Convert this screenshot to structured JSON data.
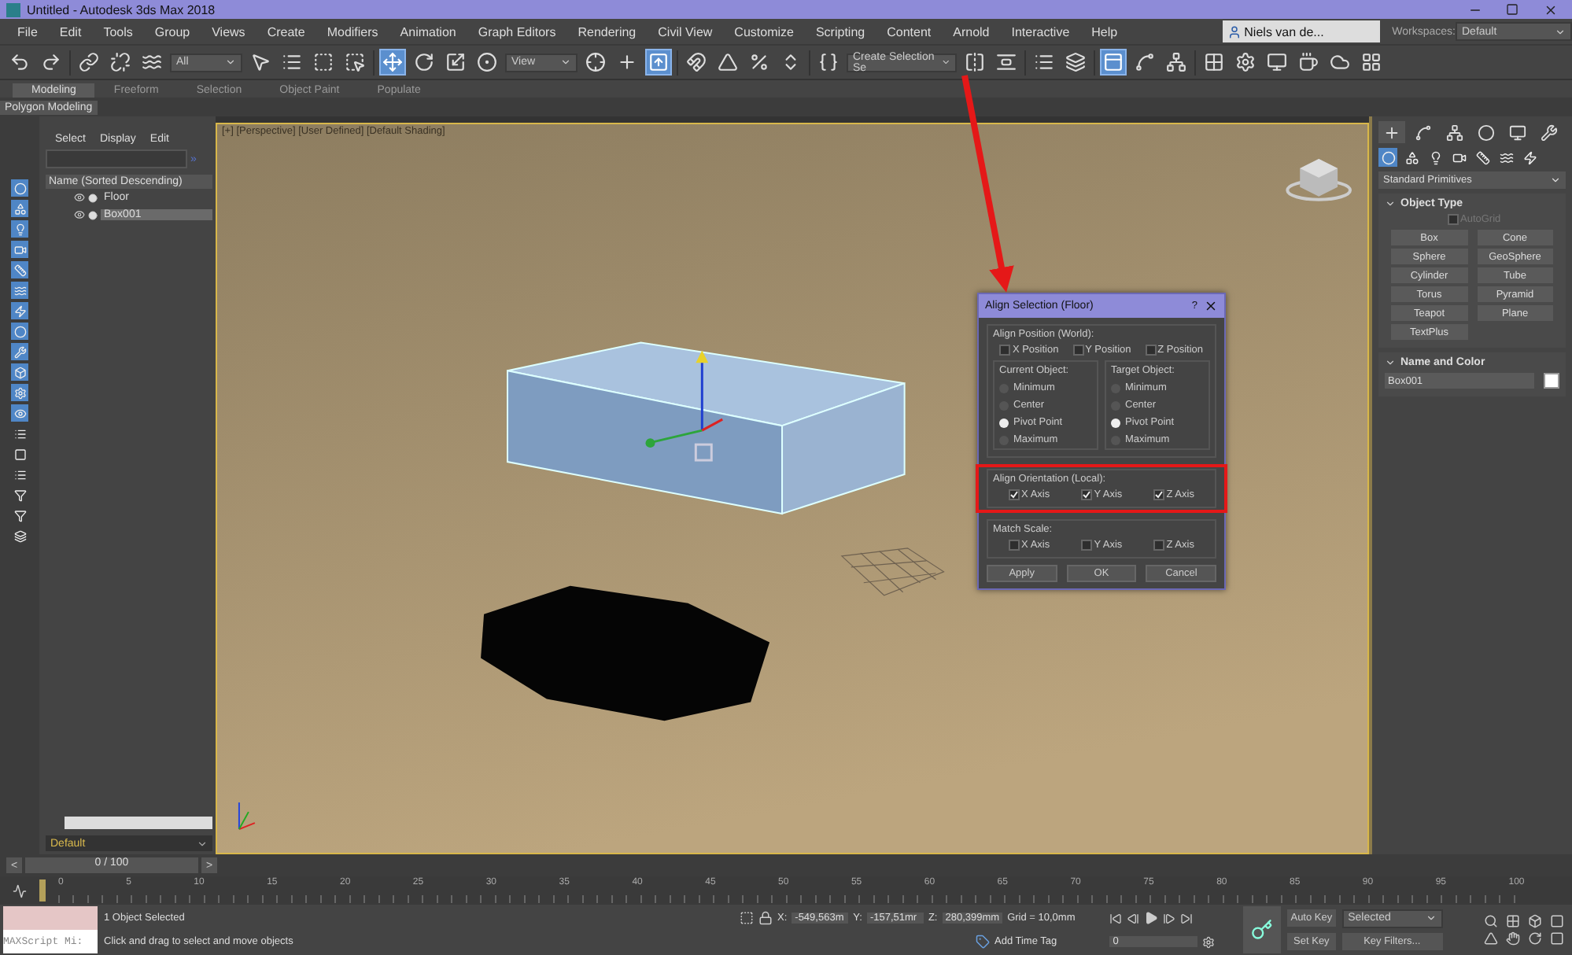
{
  "window": {
    "title": "Untitled - Autodesk 3ds Max 2018"
  },
  "menu": [
    "File",
    "Edit",
    "Tools",
    "Group",
    "Views",
    "Create",
    "Modifiers",
    "Animation",
    "Graph Editors",
    "Rendering",
    "Civil View",
    "Customize",
    "Scripting",
    "Content",
    "Arnold",
    "Interactive",
    "Help"
  ],
  "account": {
    "user": "Niels van de..."
  },
  "workspaces": {
    "label": "Workspaces:",
    "value": "Default"
  },
  "toolbar": [
    {
      "kind": "undo",
      "selected": false
    },
    {
      "kind": "redo",
      "selected": false
    },
    {
      "kind": "separator"
    },
    {
      "kind": "link",
      "selected": false
    },
    {
      "kind": "unlink",
      "selected": false
    },
    {
      "kind": "bind",
      "selected": false
    },
    {
      "kind": "dropdown",
      "value": "All"
    },
    {
      "kind": "select",
      "selected": false
    },
    {
      "kind": "list",
      "selected": false
    },
    {
      "kind": "region",
      "selected": false
    },
    {
      "kind": "crossing",
      "selected": false
    },
    {
      "kind": "separator"
    },
    {
      "kind": "move",
      "selected": true
    },
    {
      "kind": "rotate",
      "selected": false
    },
    {
      "kind": "scale",
      "selected": false
    },
    {
      "kind": "place",
      "selected": false
    },
    {
      "kind": "dropdown",
      "value": "View"
    },
    {
      "kind": "pivot",
      "selected": false
    },
    {
      "kind": "manipulate",
      "selected": false
    },
    {
      "kind": "shortcut",
      "selected": true
    },
    {
      "kind": "separator"
    },
    {
      "kind": "snap",
      "selected": false
    },
    {
      "kind": "angle",
      "selected": false
    },
    {
      "kind": "percent",
      "selected": false
    },
    {
      "kind": "spinner",
      "selected": false
    },
    {
      "kind": "separator"
    },
    {
      "kind": "named",
      "selected": false
    },
    {
      "kind": "dropdown",
      "value": "Create Selection Se"
    },
    {
      "kind": "mirror",
      "selected": false
    },
    {
      "kind": "align",
      "selected": false
    },
    {
      "kind": "separator"
    },
    {
      "kind": "list",
      "selected": false
    },
    {
      "kind": "layers",
      "selected": false
    },
    {
      "kind": "separator"
    },
    {
      "kind": "ribbon",
      "selected": true
    },
    {
      "kind": "curve",
      "selected": false
    },
    {
      "kind": "schematic",
      "selected": false
    },
    {
      "kind": "separator"
    },
    {
      "kind": "material",
      "selected": false
    },
    {
      "kind": "render-setup",
      "selected": false
    },
    {
      "kind": "frame",
      "selected": false
    },
    {
      "kind": "render",
      "selected": false
    },
    {
      "kind": "cloud",
      "selected": false
    },
    {
      "kind": "grid",
      "selected": false
    }
  ],
  "ribbon": {
    "tabs": [
      {
        "label": "Modeling",
        "selected": true
      },
      {
        "label": "Freeform",
        "selected": false
      },
      {
        "label": "Selection",
        "selected": false
      },
      {
        "label": "Object Paint",
        "selected": false
      },
      {
        "label": "Populate",
        "selected": false
      }
    ],
    "panel": "Polygon Modeling"
  },
  "scene_explorer": {
    "menu": [
      "Select",
      "Display",
      "Edit"
    ],
    "expand": "»",
    "column": "Name (Sorted Descending)",
    "items": [
      {
        "name": "Floor",
        "selected": false
      },
      {
        "name": "Box001",
        "selected": true
      }
    ],
    "layer": "Default"
  },
  "viewport": {
    "label": "[+] [Perspective] [User Defined] [Default Shading]"
  },
  "dialog": {
    "title": "Align Selection (Floor)",
    "help": "?",
    "position": {
      "title": "Align Position (World):",
      "axes": [
        {
          "label": "X Position",
          "checked": false
        },
        {
          "label": "Y Position",
          "checked": false
        },
        {
          "label": "Z Position",
          "checked": false
        }
      ],
      "groups": [
        {
          "title": "Current Object:",
          "options": [
            {
              "label": "Minimum",
              "selected": false
            },
            {
              "label": "Center",
              "selected": false
            },
            {
              "label": "Pivot Point",
              "selected": true
            },
            {
              "label": "Maximum",
              "selected": false
            }
          ]
        },
        {
          "title": "Target Object:",
          "options": [
            {
              "label": "Minimum",
              "selected": false
            },
            {
              "label": "Center",
              "selected": false
            },
            {
              "label": "Pivot Point",
              "selected": true
            },
            {
              "label": "Maximum",
              "selected": false
            }
          ]
        }
      ]
    },
    "orientation": {
      "title": "Align Orientation (Local):",
      "highlighted": true,
      "axes": [
        {
          "label": "X Axis",
          "checked": true
        },
        {
          "label": "Y Axis",
          "checked": true
        },
        {
          "label": "Z Axis",
          "checked": true
        }
      ]
    },
    "scale": {
      "title": "Match Scale:",
      "axes": [
        {
          "label": "X Axis",
          "checked": false
        },
        {
          "label": "Y Axis",
          "checked": false
        },
        {
          "label": "Z Axis",
          "checked": false
        }
      ]
    },
    "buttons": [
      "Apply",
      "OK",
      "Cancel"
    ]
  },
  "command_panel": {
    "tabs": [
      {
        "kind": "create",
        "selected": true
      },
      {
        "kind": "modify",
        "selected": false
      },
      {
        "kind": "hierarchy",
        "selected": false
      },
      {
        "kind": "motion",
        "selected": false
      },
      {
        "kind": "display",
        "selected": false
      },
      {
        "kind": "utilities",
        "selected": false
      }
    ],
    "categories": [
      {
        "kind": "geometry",
        "selected": true
      },
      {
        "kind": "shapes",
        "selected": false
      },
      {
        "kind": "lights",
        "selected": false
      },
      {
        "kind": "cameras",
        "selected": false
      },
      {
        "kind": "helpers",
        "selected": false
      },
      {
        "kind": "warps",
        "selected": false
      },
      {
        "kind": "systems",
        "selected": false
      }
    ],
    "type": "Standard Primitives",
    "object_type": {
      "title": "Object Type",
      "autogrid": {
        "label": "AutoGrid",
        "checked": false,
        "disabled": true
      },
      "buttons": [
        "Box",
        "Cone",
        "Sphere",
        "GeoSphere",
        "Cylinder",
        "Tube",
        "Torus",
        "Pyramid",
        "Teapot",
        "Plane",
        "TextPlus"
      ]
    },
    "name_color": {
      "title": "Name and Color",
      "name": "Box001",
      "color": "#ffffff"
    }
  },
  "time_slider": {
    "prev": "<",
    "frame": "0 / 100",
    "next": ">"
  },
  "track_bar": {
    "ticks": [
      "0",
      "5",
      "10",
      "15",
      "20",
      "25",
      "30",
      "35",
      "40",
      "45",
      "50",
      "55",
      "60",
      "65",
      "70",
      "75",
      "80",
      "85",
      "90",
      "95",
      "100"
    ]
  },
  "status": {
    "listener": "MAXScript Mi:",
    "selection": "1 Object Selected",
    "prompt": "Click and drag to select and move objects",
    "coords": [
      {
        "label": "X:",
        "value": "-549,563m"
      },
      {
        "label": "Y:",
        "value": "-157,51mr"
      },
      {
        "label": "Z:",
        "value": "280,399mm"
      }
    ],
    "grid": "Grid = 10,0mm",
    "add_time_tag": "Add Time Tag",
    "frame": "0",
    "auto_key": "Auto Key",
    "set_key": "Set Key",
    "key_mode": "Selected",
    "key_filters": "Key Filters..."
  }
}
